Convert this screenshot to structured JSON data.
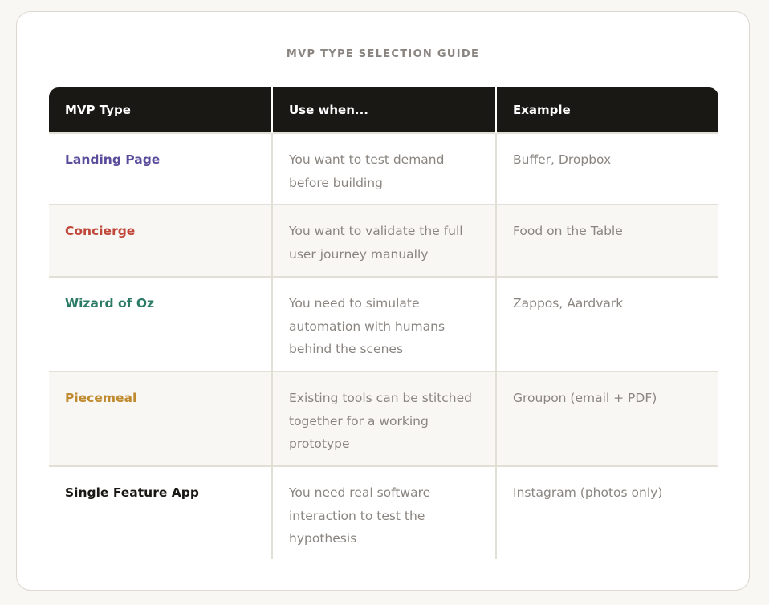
{
  "title": "MVP TYPE SELECTION GUIDE",
  "headers": [
    "MVP Type",
    "Use when...",
    "Example"
  ],
  "rows": [
    {
      "type": "Landing Page",
      "use_when": "You want to test demand before building",
      "example": "Buffer, Dropbox",
      "color": "#5b4b9b"
    },
    {
      "type": "Concierge",
      "use_when": "You want to validate the full user journey manually",
      "example": "Food on the Table",
      "color": "#c0483a"
    },
    {
      "type": "Wizard of Oz",
      "use_when": "You need to simulate automation with humans behind the scenes",
      "example": "Zappos, Aardvark",
      "color": "#2a7a66"
    },
    {
      "type": "Piecemeal",
      "use_when": "Existing tools can be stitched together for a working prototype",
      "example": "Groupon (email + PDF)",
      "color": "#c08a2e"
    },
    {
      "type": "Single Feature App",
      "use_when": "You need real software interaction to test the hypothesis",
      "example": "Instagram (photos only)",
      "color": "#1a1814"
    }
  ],
  "colors": {
    "header_bg": "#1a1814",
    "muted_text": "#8a8580",
    "alt_row_bg": "#f9f7f3"
  }
}
